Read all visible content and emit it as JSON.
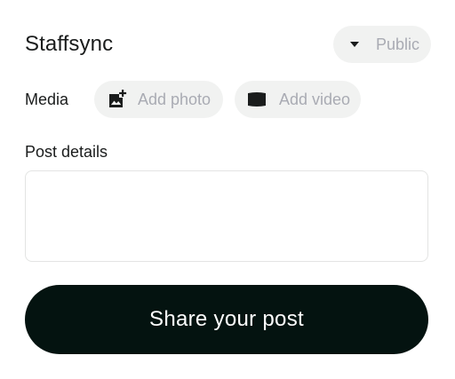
{
  "header": {
    "title": "Staffsync",
    "visibility": {
      "selected": "Public",
      "icon": "caret-down-icon"
    }
  },
  "media": {
    "label": "Media",
    "add_photo": {
      "label": "Add photo",
      "icon": "add-photo-icon"
    },
    "add_video": {
      "label": "Add video",
      "icon": "video-icon"
    }
  },
  "post_details": {
    "label": "Post details",
    "value": ""
  },
  "share_button": {
    "label": "Share your post"
  },
  "colors": {
    "chip_bg": "#f1f2f1",
    "chip_text": "#a9abb3",
    "button_bg": "#041310",
    "text": "#1a1c1c"
  }
}
